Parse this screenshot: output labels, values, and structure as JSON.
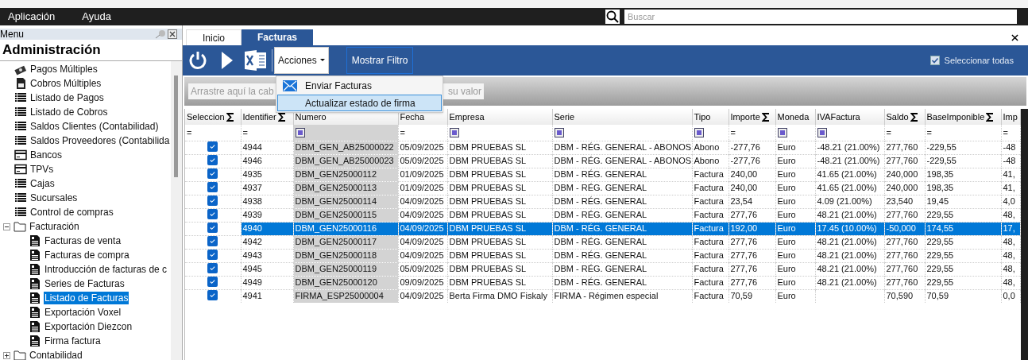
{
  "menu_bar": {
    "items": [
      "Aplicación",
      "Ayuda"
    ],
    "search": {
      "placeholder": "Buscar"
    }
  },
  "sidebar": {
    "title": "Menu",
    "heading": "Administración",
    "items": [
      {
        "label": "Pagos Múltiples",
        "kind": "money",
        "selected": false
      },
      {
        "label": "Cobros Múltiples",
        "kind": "receipt",
        "selected": false
      },
      {
        "label": "Listado de Pagos",
        "kind": "list",
        "selected": false
      },
      {
        "label": "Listado de Cobros",
        "kind": "list",
        "selected": false
      },
      {
        "label": "Saldos Clientes (Contabilidad)",
        "kind": "list",
        "selected": false
      },
      {
        "label": "Saldos Proveedores (Contabilida",
        "kind": "list",
        "selected": false
      },
      {
        "label": "Bancos",
        "kind": "card",
        "selected": false
      },
      {
        "label": "TPVs",
        "kind": "card",
        "selected": false
      },
      {
        "label": "Cajas",
        "kind": "list",
        "selected": false
      },
      {
        "label": "Sucursales",
        "kind": "list",
        "selected": false
      },
      {
        "label": "Control de compras",
        "kind": "list",
        "selected": false
      },
      {
        "label": "Facturación",
        "kind": "folder",
        "selected": false,
        "expanded": true,
        "children": [
          {
            "label": "Facturas de venta",
            "kind": "invoice",
            "selected": false
          },
          {
            "label": "Facturas de compra",
            "kind": "invoice",
            "selected": false
          },
          {
            "label": "Introducción de facturas de c",
            "kind": "invoice",
            "selected": false
          },
          {
            "label": "Series de Facturas",
            "kind": "invoice",
            "selected": false
          },
          {
            "label": "Listado de Facturas",
            "kind": "invoice",
            "selected": true
          },
          {
            "label": "Exportación Voxel",
            "kind": "invoice",
            "selected": false
          },
          {
            "label": "Exportación Diezcon",
            "kind": "invoice",
            "selected": false
          },
          {
            "label": "Firma factura",
            "kind": "invoice",
            "selected": false
          }
        ]
      },
      {
        "label": "Contabilidad",
        "kind": "folder",
        "selected": false,
        "expanded": false
      }
    ]
  },
  "tabs": [
    {
      "label": "Inicio",
      "selected": false
    },
    {
      "label": "Facturas",
      "selected": true
    }
  ],
  "toolbar": {
    "actions": {
      "label": "Acciones",
      "expanded": true,
      "items": [
        {
          "label": "Enviar Facturas",
          "kind": "mail",
          "selected": false
        },
        {
          "label": "Actualizar estado de firma",
          "kind": "plain",
          "selected": true
        }
      ]
    },
    "filter_button": "Mostrar Filtro",
    "select_all": {
      "label": "Seleccionar todas",
      "checked": true
    }
  },
  "group_bar": {
    "hint_start": "Arrastre aquí la cab",
    "hint_end": "su valor"
  },
  "table": {
    "columns": [
      {
        "label": "Seleccion",
        "sum": true,
        "filter": {
          "kind": "operator",
          "text": "="
        }
      },
      {
        "label": "Identifier",
        "sum": true,
        "filter": {
          "kind": "operator",
          "text": "="
        }
      },
      {
        "label": "Numero",
        "sum": false,
        "filter": {
          "kind": "box"
        }
      },
      {
        "label": "Fecha",
        "sum": false,
        "filter": {
          "kind": "operator",
          "text": "="
        }
      },
      {
        "label": "Empresa",
        "sum": false,
        "filter": {
          "kind": "box"
        }
      },
      {
        "label": "Serie",
        "sum": false,
        "filter": {
          "kind": "box"
        }
      },
      {
        "label": "Tipo",
        "sum": false,
        "filter": {
          "kind": "box"
        }
      },
      {
        "label": "Importe",
        "sum": true,
        "filter": {
          "kind": "operator",
          "text": "="
        }
      },
      {
        "label": "Moneda",
        "sum": false,
        "filter": {
          "kind": "box"
        }
      },
      {
        "label": "IVAFactura",
        "sum": false,
        "filter": {
          "kind": "box"
        }
      },
      {
        "label": "Saldo",
        "sum": true,
        "filter": {
          "kind": "operator",
          "text": "="
        }
      },
      {
        "label": "BaseImponible",
        "sum": true,
        "filter": {
          "kind": "operator",
          "text": "="
        }
      },
      {
        "label": "Imp",
        "sum": false,
        "filter": {
          "kind": "operator",
          "text": "="
        }
      }
    ],
    "rows": [
      {
        "selected": false,
        "checked": true,
        "cells": [
          "",
          "4944",
          "DBM_GEN_AB25000022",
          "05/09/2025",
          "DBM PRUEBAS SL",
          "DBM - RÉG. GENERAL - ABONOS",
          "Abono",
          "-277,76",
          "Euro",
          "-48.21 (21.00%)",
          "277,760",
          "-229,55",
          "-48"
        ]
      },
      {
        "selected": false,
        "checked": true,
        "cells": [
          "",
          "4946",
          "DBM_GEN_AB25000023",
          "05/09/2025",
          "DBM PRUEBAS SL",
          "DBM - RÉG. GENERAL - ABONOS",
          "Abono",
          "-277,76",
          "Euro",
          "-48.21 (21.00%)",
          "277,760",
          "-229,55",
          "-48"
        ]
      },
      {
        "selected": false,
        "checked": true,
        "cells": [
          "",
          "4935",
          "DBM_GEN25000112",
          "01/09/2025",
          "DBM PRUEBAS SL",
          "DBM - RÉG. GENERAL",
          "Factura",
          "240,00",
          "Euro",
          "41.65 (21.00%)",
          "240,000",
          "198,35",
          "41,"
        ]
      },
      {
        "selected": false,
        "checked": true,
        "cells": [
          "",
          "4937",
          "DBM_GEN25000113",
          "01/09/2025",
          "DBM PRUEBAS SL",
          "DBM - RÉG. GENERAL",
          "Factura",
          "240,00",
          "Euro",
          "41.65 (21.00%)",
          "240,000",
          "198,35",
          "41,"
        ]
      },
      {
        "selected": false,
        "checked": true,
        "cells": [
          "",
          "4938",
          "DBM_GEN25000114",
          "04/09/2025",
          "DBM PRUEBAS SL",
          "DBM - RÉG. GENERAL",
          "Factura",
          "23,54",
          "Euro",
          "4.09 (21.00%)",
          "23,540",
          "19,45",
          "4,0"
        ]
      },
      {
        "selected": false,
        "checked": true,
        "cells": [
          "",
          "4939",
          "DBM_GEN25000115",
          "04/09/2025",
          "DBM PRUEBAS SL",
          "DBM - RÉG. GENERAL",
          "Factura",
          "277,76",
          "Euro",
          "48.21 (21.00%)",
          "277,760",
          "229,55",
          "48,"
        ]
      },
      {
        "selected": true,
        "checked": true,
        "cells": [
          "",
          "4940",
          "DBM_GEN25000116",
          "04/09/2025",
          "DBM PRUEBAS SL",
          "DBM - RÉG. GENERAL",
          "Factura",
          "192,00",
          "Euro",
          "17.45 (10.00%)",
          "-50,000",
          "174,55",
          "17,"
        ]
      },
      {
        "selected": false,
        "checked": true,
        "cells": [
          "",
          "4942",
          "DBM_GEN25000117",
          "04/09/2025",
          "DBM PRUEBAS SL",
          "DBM - RÉG. GENERAL",
          "Factura",
          "277,76",
          "Euro",
          "48.21 (21.00%)",
          "277,760",
          "229,55",
          "48,"
        ]
      },
      {
        "selected": false,
        "checked": true,
        "cells": [
          "",
          "4943",
          "DBM_GEN25000118",
          "04/09/2025",
          "DBM PRUEBAS SL",
          "DBM - RÉG. GENERAL",
          "Factura",
          "277,76",
          "Euro",
          "48.21 (21.00%)",
          "277,760",
          "229,55",
          "48,"
        ]
      },
      {
        "selected": false,
        "checked": true,
        "cells": [
          "",
          "4945",
          "DBM_GEN25000119",
          "05/09/2025",
          "DBM PRUEBAS SL",
          "DBM - RÉG. GENERAL",
          "Factura",
          "277,76",
          "Euro",
          "48.21 (21.00%)",
          "277,760",
          "229,55",
          "48,"
        ]
      },
      {
        "selected": false,
        "checked": true,
        "cells": [
          "",
          "4949",
          "DBM_GEN25000120",
          "09/09/2025",
          "DBM PRUEBAS SL",
          "DBM - RÉG. GENERAL",
          "Factura",
          "277,76",
          "Euro",
          "48.21 (21.00%)",
          "277,760",
          "229,55",
          "48,"
        ]
      },
      {
        "selected": false,
        "checked": true,
        "cells": [
          "",
          "4941",
          "FIRMA_ESP25000004",
          "04/09/2025",
          "Berta Firma DMO Fiskaly",
          "FIRMA - Régimen especial",
          "Factura",
          "70,59",
          "Euro",
          null,
          "70,590",
          "70,59",
          "0,0"
        ]
      }
    ]
  }
}
